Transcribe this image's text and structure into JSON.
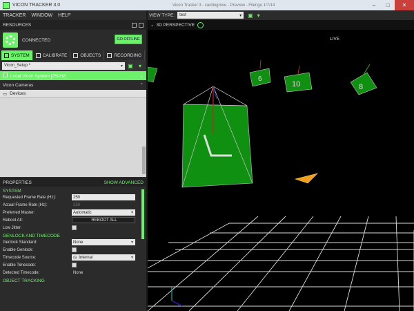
{
  "app": {
    "title": "VICON TRACKER 3.0",
    "center_title": "Vicon Tracker 3 - cardiogrove - Preview - Filenge 1/7/14"
  },
  "menu": [
    {
      "label": "TRACKER",
      "u": "T"
    },
    {
      "label": "WINDOW",
      "u": "W"
    },
    {
      "label": "HELP",
      "u": "H"
    }
  ],
  "resources": {
    "header": "RESOURCES",
    "status": "CONNECTED",
    "go_offline": "GO OFFLINE"
  },
  "tabs": [
    "SYSTEM",
    "CALIBRATE",
    "OBJECTS",
    "RECORDING"
  ],
  "config": {
    "name": "Vicon_Setup *"
  },
  "system_rows": {
    "local_system": "Local Vicon System [250Hz]",
    "cameras": "Vicon Cameras",
    "devices": "Devices"
  },
  "properties": {
    "header": "PROPERTIES",
    "show_advanced": "SHOW ADVANCED",
    "sections": {
      "system": "SYSTEM",
      "genlock": "GENLOCK AND TIMECODE",
      "tracking": "OBJECT TRACKING"
    },
    "requested_rate_label": "Requested Frame Rate (Hz):",
    "requested_rate_value": "250",
    "actual_rate_label": "Actual Frame Rate (Hz):",
    "actual_rate_value": "250",
    "preferred_master_label": "Preferred Master:",
    "preferred_master_value": "Automatic",
    "reboot_all_label": "Reboot All:",
    "reboot_all_button": "REBOOT ALL",
    "low_jitter_label": "Low Jitter:",
    "genlock_standard_label": "Genlock Standard:",
    "genlock_standard_value": "None",
    "enable_genlock_label": "Enable Genlock:",
    "timecode_source_label": "Timecode Source:",
    "timecode_source_value": "Internal",
    "enable_timecode_label": "Enable Timecode:",
    "detected_timecode_label": "Detected Timecode:",
    "detected_timecode_value": "None"
  },
  "viewport": {
    "view_type_label": "VIEW TYPE:",
    "view_type_value": "test",
    "perspective_label": "3D PERSPECTIVE",
    "live_label": "LIVE",
    "markers": [
      "6",
      "10",
      "8"
    ]
  },
  "colors": {
    "accent": "#6df06a",
    "object_green": "#109010",
    "background": "#000000"
  }
}
